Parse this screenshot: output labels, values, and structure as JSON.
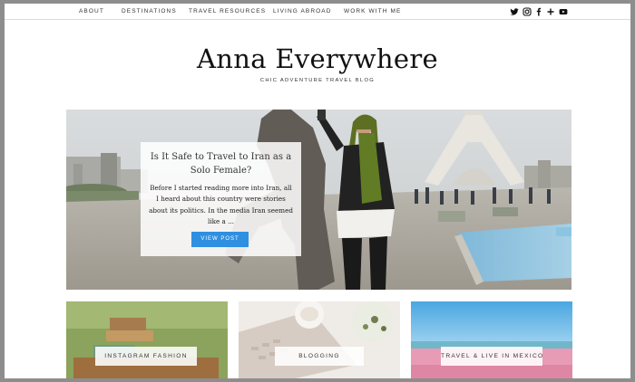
{
  "nav": {
    "items": [
      {
        "label": "ABOUT"
      },
      {
        "label": "DESTINATIONS"
      },
      {
        "label": "TRAVEL RESOURCES"
      },
      {
        "label": "LIVING ABROAD"
      },
      {
        "label": "WORK WITH ME"
      }
    ],
    "social": [
      "twitter-icon",
      "instagram-icon",
      "facebook-icon",
      "google-plus-icon",
      "youtube-icon"
    ]
  },
  "header": {
    "title": "Anna Everywhere",
    "tagline": "CHIC ADVENTURE TRAVEL BLOG"
  },
  "featured": {
    "title": "Is It Safe to Travel to Iran as a Solo Female?",
    "excerpt": "Before I started reading more into Iran, all I heard about this country were stories about its politics. In the media Iran seemed like a ...",
    "button": "VIEW POST"
  },
  "categories": [
    {
      "label": "INSTAGRAM FASHION"
    },
    {
      "label": "BLOGGING"
    },
    {
      "label": "TRAVEL & LIVE IN MEXICO"
    }
  ],
  "colors": {
    "accent": "#2f8fe0",
    "text": "#333333"
  }
}
